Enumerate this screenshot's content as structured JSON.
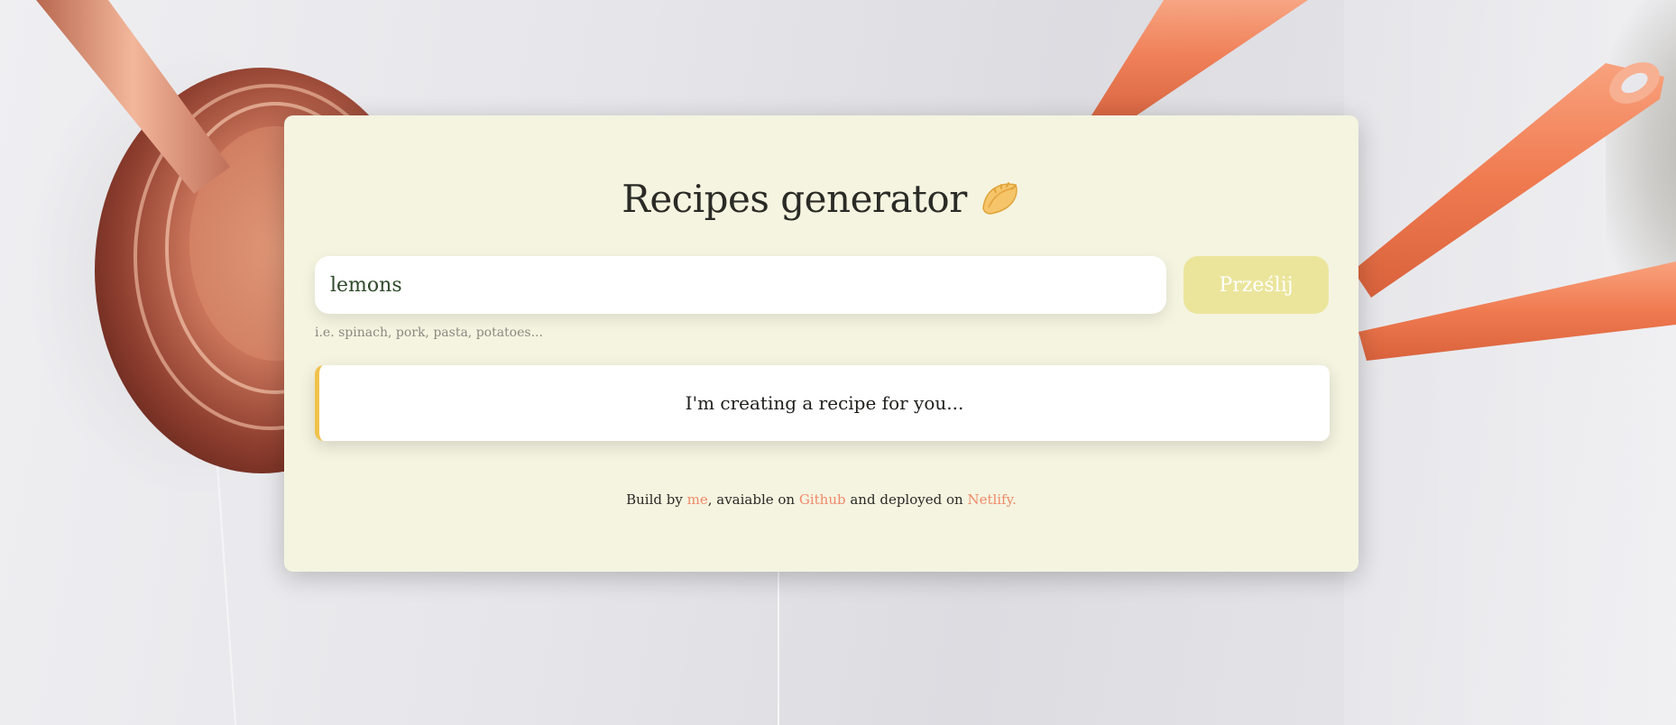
{
  "app": {
    "title": "Recipes generator",
    "title_icon": "dumpling-icon"
  },
  "search": {
    "value": "lemons",
    "hint": "i.e. spinach, pork, pasta, potatoes...",
    "submit_label": "Prześlij"
  },
  "status": {
    "message": "I'm creating a recipe for you..."
  },
  "footer": {
    "prefix": "Build by ",
    "link_me": "me",
    "middle1": ", avaiable on ",
    "link_github": "Github",
    "middle2": " and deployed on ",
    "link_netlify": "Netlify."
  },
  "colors": {
    "card_background": "#f5f4e0",
    "button_background": "#ebe59c",
    "status_accent": "#f0c24b",
    "link": "#f08a6a"
  }
}
